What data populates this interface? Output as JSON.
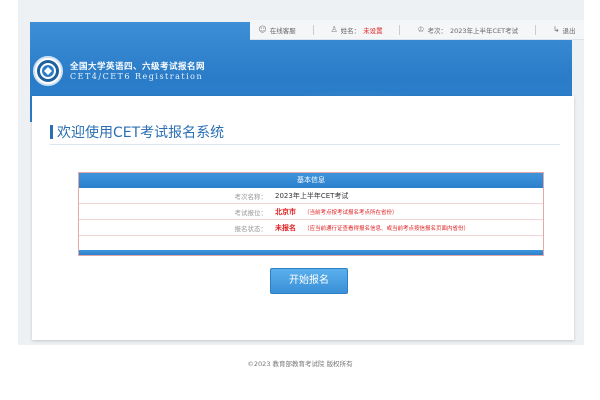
{
  "top_bar": {
    "home": "在线客服",
    "name_label": "姓名：",
    "name_value": "未设置",
    "exam_label": "考次：",
    "exam_value": "2023年上半年CET考试",
    "logout": "退出"
  },
  "site": {
    "title": "全国大学英语四、六级考试报名网",
    "subtitle": "CET4/CET6 Registration"
  },
  "welcome": "欢迎使用CET考试报名系统",
  "info": {
    "header": "基本信息",
    "rows": [
      {
        "label": "考次名称：",
        "value": "2023年上半年CET考试",
        "note": ""
      },
      {
        "label": "考试报位：",
        "value": "北京市",
        "note": "（当前考点按考试报名考点所在省份）"
      },
      {
        "label": "报名状态：",
        "value": "未报名",
        "note": "（应当前通行证查看得报名信息、或当前考点按信报名页面内省份）"
      }
    ]
  },
  "start_button": "开始报名",
  "footer": "©2023  教育部教育考试院  版权所有",
  "colors": {
    "banner": "#2a7cc8",
    "accent": "#2a6fb5",
    "red": "#e02020"
  }
}
